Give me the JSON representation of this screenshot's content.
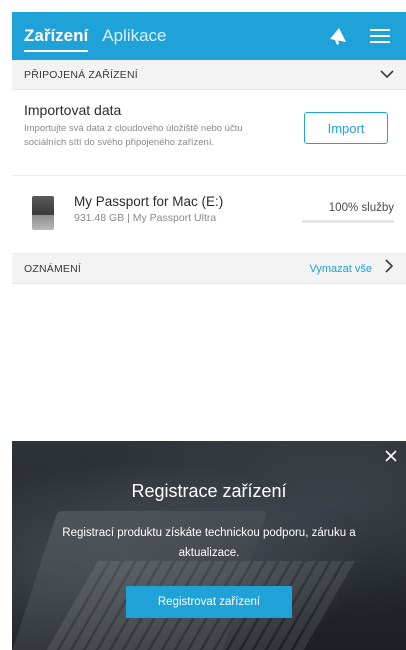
{
  "header": {
    "tabs": [
      {
        "label": "Zařízení",
        "active": true
      },
      {
        "label": "Aplikace",
        "active": false
      }
    ],
    "icons": [
      "megaphone-icon",
      "menu-icon"
    ],
    "color": "#1ea2d8"
  },
  "connected": {
    "section_title": "PŘIPOJENÁ ZAŘÍZENÍ",
    "import": {
      "title": "Importovat data",
      "description": "Importujte svá data z cloudového úložiště nebo účtu sociálních sítí do svého připojeného zařízení.",
      "button_label": "Import"
    },
    "device": {
      "name": "My Passport for Mac (E:)",
      "meta": "931.48 GB | My Passport Ultra",
      "status": "100% služby",
      "status_fraction": 1.0
    }
  },
  "notifications": {
    "section_title": "OZNÁMENÍ",
    "clear_all": "Vymazat vše"
  },
  "promo": {
    "title": "Registrace zařízení",
    "description": "Registrací produktu získáte technickou podporu, záruku a aktualizace.",
    "button_label": "Registrovat zařízení"
  }
}
